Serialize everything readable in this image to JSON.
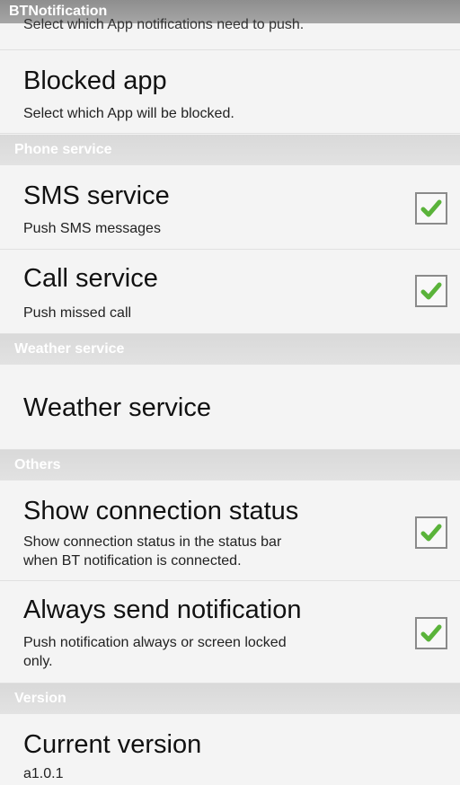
{
  "app": {
    "title": "BTNotification"
  },
  "cutoff_text": "Select which App notifications need to push.",
  "rows": [
    {
      "title": "Blocked app",
      "subtitle": "Select which App will be blocked."
    },
    {
      "title": "SMS service",
      "subtitle": "Push SMS messages",
      "checked": true
    },
    {
      "title": "Call service",
      "subtitle": "Push missed call",
      "checked": true
    },
    {
      "title": "Weather service"
    },
    {
      "title": "Show connection status",
      "subtitle_line1": "Show connection status in the status bar",
      "subtitle_line2": "when BT notification is connected.",
      "checked": true
    },
    {
      "title": "Always send notification",
      "subtitle_line1": "Push notification always or screen locked",
      "subtitle_line2": "only.",
      "checked": true
    },
    {
      "title": "Current version",
      "subtitle": "a1.0.1"
    }
  ],
  "sections": {
    "phone": "Phone service",
    "weather": "Weather service",
    "others": "Others",
    "version": "Version"
  },
  "colors": {
    "check": "#5ab33a",
    "section_bg": "#dcdcdc",
    "title_bar": "#9a9a9a"
  },
  "icons": {
    "checkbox": "checkmark-icon"
  }
}
